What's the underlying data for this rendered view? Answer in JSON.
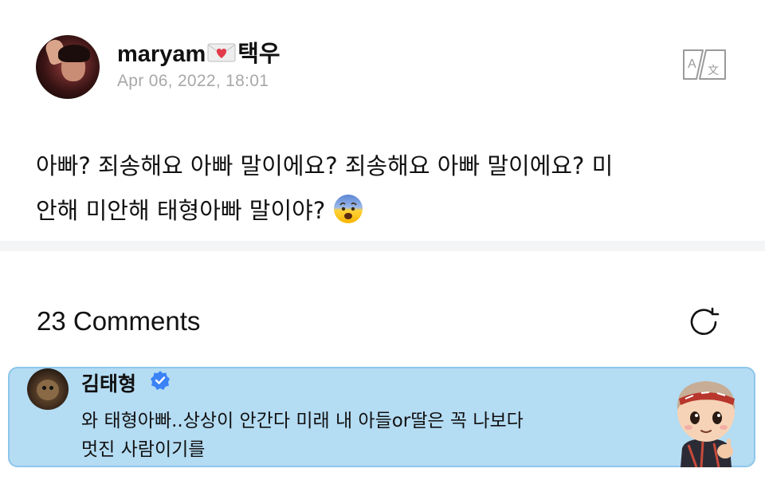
{
  "post": {
    "author_name_part1": "maryam",
    "author_name_part2": "택우",
    "author_name_icon": "love-letter-icon",
    "date": "Apr 06, 2022, 18:01",
    "translate_icon": "translate-icon",
    "text_line1": "아빠?  죄송해요 아빠 말이에요?  죄송해요 아빠 말이에요?  미",
    "text_line2": "안해 미안해 태형아빠 말이야? ",
    "text_emoji": "fearful-face-emoji"
  },
  "comments": {
    "count_label": "23 Comments",
    "refresh_icon": "refresh-icon",
    "highlighted": {
      "author": "김태형",
      "verified_icon": "verified-badge-icon",
      "text_line1": "와 태형아빠..상상이 안간다 미래 내 아들or딸은 꼭 나보다",
      "text_line2": "멋진 사람이기를",
      "sticker": "character-sticker"
    }
  },
  "colors": {
    "highlight_bg": "#b4dcf3",
    "highlight_border": "#8ec6ea",
    "verified_blue": "#3b82f6",
    "date_gray": "#a8a8a8"
  }
}
